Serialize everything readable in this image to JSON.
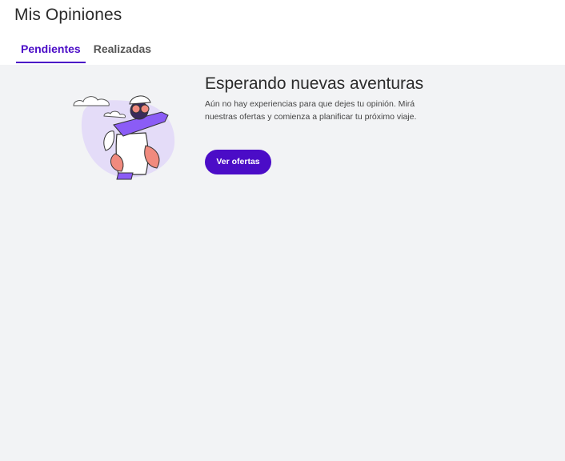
{
  "page": {
    "title": "Mis Opiniones"
  },
  "tabs": [
    {
      "label": "Pendientes",
      "active": true
    },
    {
      "label": "Realizadas",
      "active": false
    }
  ],
  "empty_state": {
    "title": "Esperando nuevas aventuras",
    "description": "Aún no hay experiencias para que dejes tu opinión. Mirá nuestras ofertas y comienza a planificar tu próximo viaje.",
    "cta_label": "Ver ofertas",
    "illustration": "traveler-with-binoculars-illustration"
  },
  "colors": {
    "accent": "#4b0cc7",
    "background": "#f2f3f5",
    "illustration_lilac": "#e4dcf8",
    "illustration_coral": "#f08a7e"
  }
}
